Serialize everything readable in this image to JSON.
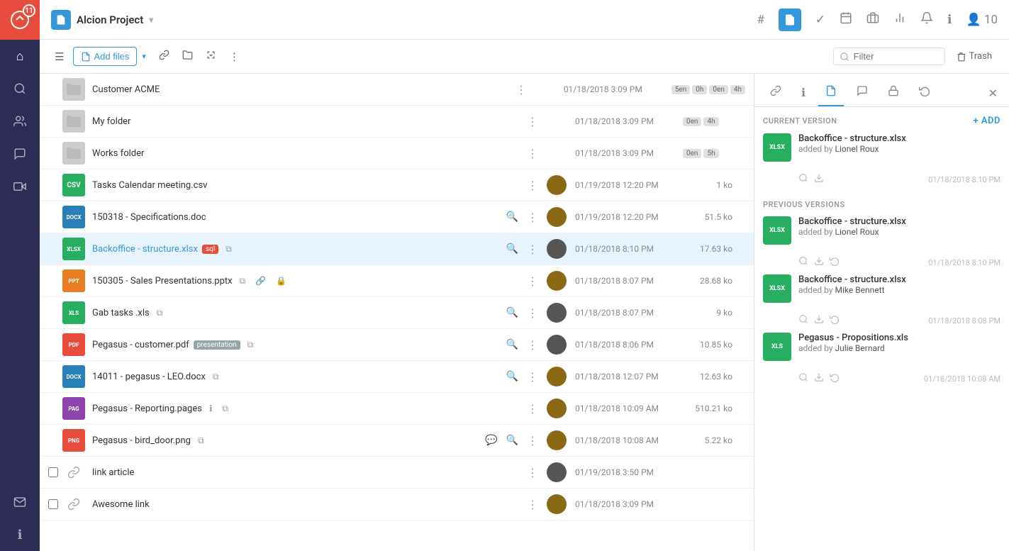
{
  "app": {
    "name": "Alcion Project",
    "badge": "11"
  },
  "topnav": {
    "project_icon": "A",
    "project_name": "Alcion Project",
    "icons": [
      "hash",
      "document",
      "check",
      "calendar",
      "briefcase",
      "chart",
      "bell",
      "info",
      "user"
    ]
  },
  "toolbar": {
    "add_files_label": "Add files",
    "trash_label": "Trash",
    "filter_placeholder": "Filter"
  },
  "files": [
    {
      "id": 1,
      "type": "folder",
      "name": "Customer ACME",
      "date": "01/18/2018 3:09 PM",
      "size": "",
      "has_checkbox": false,
      "versions": [
        "5en",
        "0h",
        "0en",
        "4h"
      ]
    },
    {
      "id": 2,
      "type": "folder",
      "name": "My folder",
      "date": "01/18/2018 3:09 PM",
      "size": "",
      "has_checkbox": false,
      "versions": [
        "0en",
        "4h"
      ]
    },
    {
      "id": 3,
      "type": "folder",
      "name": "Works folder",
      "date": "01/18/2018 3:09 PM",
      "size": "",
      "has_checkbox": false,
      "versions": [
        "0en",
        "5h"
      ]
    },
    {
      "id": 4,
      "type": "csv",
      "name": "Tasks Calendar meeting.csv",
      "date": "01/19/2018 12:20 PM",
      "size": "1 ko",
      "avatar_color": "#8B6914"
    },
    {
      "id": 5,
      "type": "docx",
      "name": "150318 - Specifications.doc",
      "date": "01/19/2018 12:20 PM",
      "size": "51.5 ko",
      "avatar_color": "#8B6914"
    },
    {
      "id": 6,
      "type": "xlsx",
      "name": "Backoffice - structure.xlsx",
      "date": "01/18/2018 8:10 PM",
      "size": "17.63 ko",
      "selected": true,
      "badges": [
        "sql"
      ],
      "avatar_color": "#555"
    },
    {
      "id": 7,
      "type": "pptx",
      "name": "150305 - Sales Presentations.pptx",
      "date": "01/18/2018 8:07 PM",
      "size": "28.68 ko",
      "avatar_color": "#8B6914"
    },
    {
      "id": 8,
      "type": "xls",
      "name": "Gab tasks .xls",
      "date": "01/18/2018 8:07 PM",
      "size": "9 ko",
      "avatar_color": "#555"
    },
    {
      "id": 9,
      "type": "pdf",
      "name": "Pegasus - customer.pdf",
      "date": "01/18/2018 8:06 PM",
      "size": "10.85 ko",
      "badges": [
        "presentation"
      ],
      "avatar_color": "#555"
    },
    {
      "id": 10,
      "type": "docx",
      "name": "14011 - pegasus - LEO.docx",
      "date": "01/18/2018 12:07 PM",
      "size": "12.63 ko",
      "avatar_color": "#8B6914"
    },
    {
      "id": 11,
      "type": "pac",
      "name": "Pegasus - Reporting.pages",
      "date": "01/18/2018 10:09 AM",
      "size": "510.21 ko",
      "avatar_color": "#8B6914"
    },
    {
      "id": 12,
      "type": "png",
      "name": "Pegasus - bird_door.png",
      "date": "01/18/2018 10:08 AM",
      "size": "5.22 ko",
      "avatar_color": "#8B6914",
      "has_comment": true
    },
    {
      "id": 13,
      "type": "link",
      "name": "link article",
      "date": "01/19/2018 3:50 PM",
      "size": "",
      "has_checkbox": true,
      "avatar_color": "#555"
    },
    {
      "id": 14,
      "type": "link",
      "name": "Awesome link",
      "date": "01/18/2018 3:09 PM",
      "size": "",
      "has_checkbox": true,
      "avatar_color": "#8B6914"
    }
  ],
  "right_panel": {
    "current_version_title": "CURRENT VERSION",
    "previous_versions_title": "PREVIOUS VERSIONS",
    "add_label": "+ Add",
    "versions": [
      {
        "id": 1,
        "filename": "Backoffice - structure.xlsx",
        "added_by": "Lionel Roux",
        "date": "01/18/2018 8:10 PM",
        "section": "current",
        "icon_type": "xlsx"
      },
      {
        "id": 2,
        "filename": "Backoffice - structure.xlsx",
        "added_by": "Lionel Roux",
        "date": "01/18/2018 8:10 PM",
        "section": "previous",
        "icon_type": "xlsx"
      },
      {
        "id": 3,
        "filename": "Backoffice - structure.xlsx",
        "added_by": "Mike Bennett",
        "date": "01/18/2018 8:08 PM",
        "section": "previous",
        "icon_type": "xlsx"
      },
      {
        "id": 4,
        "filename": "Pegasus - Propositions.xls",
        "added_by": "Julie Bernard",
        "date": "01/18/2018 10:08 AM",
        "section": "previous",
        "icon_type": "xls"
      }
    ]
  }
}
